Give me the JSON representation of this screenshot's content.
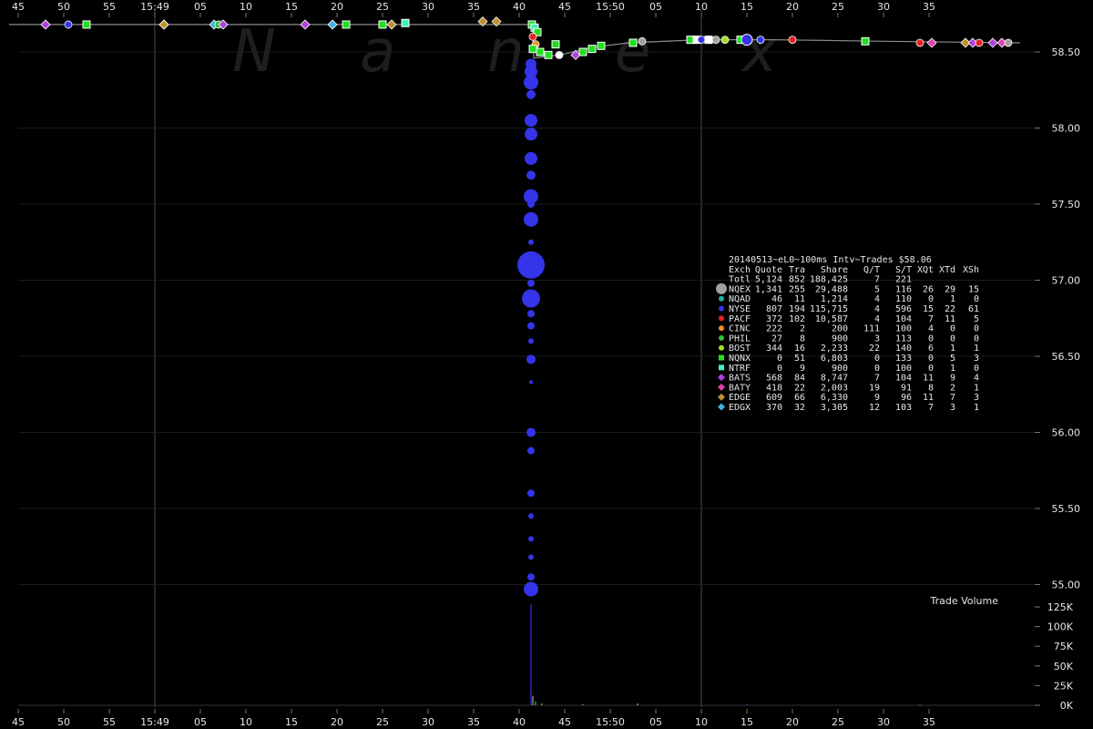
{
  "chart_data": {
    "type": "scatter",
    "watermark": [
      "N",
      "a",
      "n",
      "e",
      "x"
    ],
    "x_ticks": {
      "top": [
        "45",
        "50",
        "55",
        "15:49",
        "05",
        "10",
        "15",
        "20",
        "25",
        "30",
        "35",
        "40",
        "45",
        "15:50",
        "05",
        "10",
        "15",
        "20",
        "25",
        "30",
        "35"
      ],
      "bottom": [
        "45",
        "50",
        "55",
        "15:49",
        "05",
        "10",
        "15",
        "20",
        "25",
        "30",
        "35",
        "40",
        "45",
        "15:50",
        "05",
        "10",
        "15",
        "20",
        "25",
        "30",
        "35"
      ]
    },
    "price_axis": {
      "ylim": [
        54.83,
        58.75
      ],
      "ticks": [
        "58.50",
        "58.00",
        "57.50",
        "57.00",
        "56.50",
        "56.00",
        "55.50",
        "55.00"
      ]
    },
    "volume_axis": {
      "title": "Trade Volume",
      "ylim": [
        0,
        130000
      ],
      "ticks": [
        "125K",
        "100K",
        "75K",
        "50K",
        "25K",
        "0K"
      ]
    },
    "stats_table": {
      "title": "20140513~eL0~100ms Intv~Trades $58.06",
      "header": [
        "Exch",
        "Quote",
        "Tra",
        "Share",
        "Q/T",
        "S/T",
        "XQt",
        "XTd",
        "XSh"
      ],
      "rows": [
        {
          "name": "Totl",
          "marker": "none",
          "color": "",
          "values": [
            "5,124",
            "852",
            "188,425",
            "7",
            "221",
            "",
            "",
            ""
          ]
        },
        {
          "name": "NQEX",
          "marker": "circle-lg",
          "color": "#a0a0a0",
          "values": [
            "1,341",
            "255",
            "29,488",
            "5",
            "116",
            "26",
            "29",
            "15"
          ]
        },
        {
          "name": "NQAD",
          "marker": "circle",
          "color": "#20b0a0",
          "values": [
            "46",
            "11",
            "1,214",
            "4",
            "110",
            "0",
            "1",
            "0"
          ]
        },
        {
          "name": "NYSE",
          "marker": "circle",
          "color": "#3434e8",
          "values": [
            "807",
            "194",
            "115,715",
            "4",
            "596",
            "15",
            "22",
            "61"
          ]
        },
        {
          "name": "PACF",
          "marker": "circle",
          "color": "#e82020",
          "values": [
            "372",
            "102",
            "10,587",
            "4",
            "104",
            "7",
            "11",
            "5"
          ]
        },
        {
          "name": "CINC",
          "marker": "circle",
          "color": "#f09020",
          "values": [
            "222",
            "2",
            "200",
            "111",
            "100",
            "4",
            "0",
            "0"
          ]
        },
        {
          "name": "PHIL",
          "marker": "circle",
          "color": "#30c030",
          "values": [
            "27",
            "8",
            "900",
            "3",
            "113",
            "0",
            "0",
            "0"
          ]
        },
        {
          "name": "BOST",
          "marker": "circle",
          "color": "#a0e020",
          "values": [
            "344",
            "16",
            "2,233",
            "22",
            "140",
            "6",
            "1",
            "1"
          ]
        },
        {
          "name": "NQNX",
          "marker": "square",
          "color": "#20e020",
          "values": [
            "0",
            "51",
            "6,803",
            "0",
            "133",
            "0",
            "5",
            "3"
          ]
        },
        {
          "name": "NTRF",
          "marker": "square",
          "color": "#40f0c0",
          "values": [
            "0",
            "9",
            "900",
            "0",
            "100",
            "0",
            "1",
            "0"
          ]
        },
        {
          "name": "BATS",
          "marker": "diamond",
          "color": "#b040e0",
          "values": [
            "568",
            "84",
            "8,747",
            "7",
            "104",
            "11",
            "9",
            "4"
          ]
        },
        {
          "name": "BATY",
          "marker": "diamond",
          "color": "#e040b0",
          "values": [
            "418",
            "22",
            "2,003",
            "19",
            "91",
            "8",
            "2",
            "1"
          ]
        },
        {
          "name": "EDGE",
          "marker": "diamond",
          "color": "#c09030",
          "values": [
            "609",
            "66",
            "6,330",
            "9",
            "96",
            "11",
            "7",
            "3"
          ]
        },
        {
          "name": "EDGX",
          "marker": "diamond",
          "color": "#40b0e0",
          "values": [
            "370",
            "32",
            "3,305",
            "12",
            "103",
            "7",
            "3",
            "1"
          ]
        }
      ]
    },
    "nbbo_line": [
      {
        "t": -16.0,
        "p": 58.68
      },
      {
        "t": 41.5,
        "p": 58.68
      },
      {
        "t": 41.6,
        "p": 58.46
      },
      {
        "t": 43.0,
        "p": 58.47
      },
      {
        "t": 44.5,
        "p": 58.48
      },
      {
        "t": 48.0,
        "p": 58.53
      },
      {
        "t": 52.0,
        "p": 58.56
      },
      {
        "t": 60.0,
        "p": 58.58
      },
      {
        "t": 68.0,
        "p": 58.58
      },
      {
        "t": 80.0,
        "p": 58.57
      },
      {
        "t": 95.0,
        "p": 58.56
      }
    ],
    "nyse_sweep": [
      {
        "t": 41.3,
        "p": 58.42,
        "s": 6
      },
      {
        "t": 41.3,
        "p": 58.37,
        "s": 7
      },
      {
        "t": 41.3,
        "p": 58.3,
        "s": 8
      },
      {
        "t": 41.3,
        "p": 58.22,
        "s": 5
      },
      {
        "t": 41.3,
        "p": 58.05,
        "s": 7
      },
      {
        "t": 41.3,
        "p": 57.96,
        "s": 7
      },
      {
        "t": 41.3,
        "p": 57.8,
        "s": 7
      },
      {
        "t": 41.3,
        "p": 57.69,
        "s": 5
      },
      {
        "t": 41.3,
        "p": 57.55,
        "s": 8
      },
      {
        "t": 41.3,
        "p": 57.5,
        "s": 4
      },
      {
        "t": 41.3,
        "p": 57.4,
        "s": 8
      },
      {
        "t": 41.3,
        "p": 57.25,
        "s": 3
      },
      {
        "t": 41.3,
        "p": 57.1,
        "s": 15
      },
      {
        "t": 41.3,
        "p": 56.98,
        "s": 4
      },
      {
        "t": 41.3,
        "p": 56.88,
        "s": 10
      },
      {
        "t": 41.3,
        "p": 56.78,
        "s": 4
      },
      {
        "t": 41.3,
        "p": 56.7,
        "s": 4
      },
      {
        "t": 41.3,
        "p": 56.6,
        "s": 3
      },
      {
        "t": 41.3,
        "p": 56.48,
        "s": 5
      },
      {
        "t": 41.3,
        "p": 56.33,
        "s": 2
      },
      {
        "t": 41.3,
        "p": 56.0,
        "s": 5
      },
      {
        "t": 41.3,
        "p": 55.88,
        "s": 4
      },
      {
        "t": 41.3,
        "p": 55.6,
        "s": 4
      },
      {
        "t": 41.3,
        "p": 55.45,
        "s": 3
      },
      {
        "t": 41.3,
        "p": 55.3,
        "s": 3
      },
      {
        "t": 41.3,
        "p": 55.18,
        "s": 3
      },
      {
        "t": 41.3,
        "p": 55.05,
        "s": 4
      },
      {
        "t": 41.3,
        "p": 54.97,
        "s": 8
      }
    ],
    "venue_trades": [
      {
        "t": -12.0,
        "p": 58.68,
        "m": "diamond",
        "c": "#b040e0"
      },
      {
        "t": -9.5,
        "p": 58.68,
        "m": "circle",
        "c": "#3434e8"
      },
      {
        "t": -7.5,
        "p": 58.68,
        "m": "square",
        "c": "#20e020"
      },
      {
        "t": 1.0,
        "p": 58.68,
        "m": "diamond",
        "c": "#b040e0"
      },
      {
        "t": 1.0,
        "p": 58.68,
        "m": "diamond",
        "c": "#c09030"
      },
      {
        "t": 6.5,
        "p": 58.68,
        "m": "diamond",
        "c": "#40b0e0"
      },
      {
        "t": 7.0,
        "p": 58.68,
        "m": "circle",
        "c": "#30c030"
      },
      {
        "t": 7.5,
        "p": 58.68,
        "m": "diamond",
        "c": "#b040e0"
      },
      {
        "t": 16.5,
        "p": 58.68,
        "m": "diamond",
        "c": "#b040e0"
      },
      {
        "t": 19.5,
        "p": 58.68,
        "m": "diamond",
        "c": "#40b0e0"
      },
      {
        "t": 21.0,
        "p": 58.68,
        "m": "square",
        "c": "#20e020"
      },
      {
        "t": 25.0,
        "p": 58.68,
        "m": "square",
        "c": "#20e020"
      },
      {
        "t": 26.0,
        "p": 58.68,
        "m": "diamond",
        "c": "#c09030"
      },
      {
        "t": 27.5,
        "p": 58.69,
        "m": "square",
        "c": "#40f0c0"
      },
      {
        "t": 36.0,
        "p": 58.7,
        "m": "diamond",
        "c": "#c09030"
      },
      {
        "t": 37.5,
        "p": 58.7,
        "m": "diamond",
        "c": "#c09030"
      },
      {
        "t": 41.4,
        "p": 58.68,
        "m": "square",
        "c": "#20e020"
      },
      {
        "t": 41.7,
        "p": 58.66,
        "m": "square",
        "c": "#40f0c0"
      },
      {
        "t": 42.0,
        "p": 58.63,
        "m": "square",
        "c": "#20e020"
      },
      {
        "t": 41.5,
        "p": 58.6,
        "m": "circle",
        "c": "#e82020"
      },
      {
        "t": 41.8,
        "p": 58.55,
        "m": "circle",
        "c": "#f09020"
      },
      {
        "t": 41.5,
        "p": 58.52,
        "m": "square",
        "c": "#20e020"
      },
      {
        "t": 42.3,
        "p": 58.5,
        "m": "square",
        "c": "#20e020"
      },
      {
        "t": 43.2,
        "p": 58.48,
        "m": "square",
        "c": "#20e020"
      },
      {
        "t": 44.4,
        "p": 58.48,
        "m": "circle",
        "c": "#ffffff"
      },
      {
        "t": 44.0,
        "p": 58.55,
        "m": "square",
        "c": "#20e020"
      },
      {
        "t": 46.2,
        "p": 58.48,
        "m": "diamond",
        "c": "#b040e0"
      },
      {
        "t": 47.0,
        "p": 58.5,
        "m": "square",
        "c": "#20e020"
      },
      {
        "t": 48.0,
        "p": 58.52,
        "m": "square",
        "c": "#20e020"
      },
      {
        "t": 49.0,
        "p": 58.54,
        "m": "square",
        "c": "#20e020"
      },
      {
        "t": 52.5,
        "p": 58.56,
        "m": "square",
        "c": "#20e020"
      },
      {
        "t": 53.5,
        "p": 58.57,
        "m": "circle",
        "c": "#a0a0a0"
      },
      {
        "t": 58.8,
        "p": 58.58,
        "m": "square",
        "c": "#20e020"
      },
      {
        "t": 59.5,
        "p": 58.58,
        "m": "square",
        "c": "#ffffff"
      },
      {
        "t": 60.0,
        "p": 58.58,
        "m": "circle",
        "c": "#3434e8"
      },
      {
        "t": 60.8,
        "p": 58.58,
        "m": "square",
        "c": "#ffffff"
      },
      {
        "t": 61.6,
        "p": 58.58,
        "m": "circle",
        "c": "#a0a0a0"
      },
      {
        "t": 62.6,
        "p": 58.58,
        "m": "circle",
        "c": "#a0e020"
      },
      {
        "t": 64.3,
        "p": 58.58,
        "m": "square",
        "c": "#20e020"
      },
      {
        "t": 65.0,
        "p": 58.58,
        "m": "circle-lg",
        "c": "#3434e8"
      },
      {
        "t": 66.5,
        "p": 58.58,
        "m": "circle",
        "c": "#3434e8"
      },
      {
        "t": 70.0,
        "p": 58.58,
        "m": "circle",
        "c": "#e82020"
      },
      {
        "t": 78.0,
        "p": 58.57,
        "m": "square",
        "c": "#20e020"
      },
      {
        "t": 84.0,
        "p": 58.56,
        "m": "circle",
        "c": "#e82020"
      },
      {
        "t": 85.3,
        "p": 58.56,
        "m": "diamond",
        "c": "#e040b0"
      },
      {
        "t": 89.0,
        "p": 58.56,
        "m": "diamond",
        "c": "#c09030"
      },
      {
        "t": 89.8,
        "p": 58.56,
        "m": "diamond",
        "c": "#b040e0"
      },
      {
        "t": 90.5,
        "p": 58.56,
        "m": "circle",
        "c": "#e82020"
      },
      {
        "t": 92.0,
        "p": 58.56,
        "m": "diamond",
        "c": "#b040e0"
      },
      {
        "t": 93.0,
        "p": 58.56,
        "m": "diamond",
        "c": "#e040b0"
      },
      {
        "t": 93.7,
        "p": 58.56,
        "m": "circle",
        "c": "#a0a0a0"
      }
    ],
    "volume_bars": [
      {
        "t": 41.3,
        "v": 128000,
        "c": "#3434e8"
      },
      {
        "t": 41.5,
        "v": 12000,
        "c": "#a0a0a0"
      },
      {
        "t": 41.8,
        "v": 5000,
        "c": "#20e020"
      },
      {
        "t": 42.5,
        "v": 2500,
        "c": "#a0a0a0"
      },
      {
        "t": 47.0,
        "v": 1500,
        "c": "#a0a0a0"
      },
      {
        "t": 53.0,
        "v": 2500,
        "c": "#a0a0a0"
      },
      {
        "t": 65.0,
        "v": 2000,
        "c": "#3434e8"
      },
      {
        "t": 84.0,
        "v": 1500,
        "c": "#e82020"
      }
    ]
  }
}
